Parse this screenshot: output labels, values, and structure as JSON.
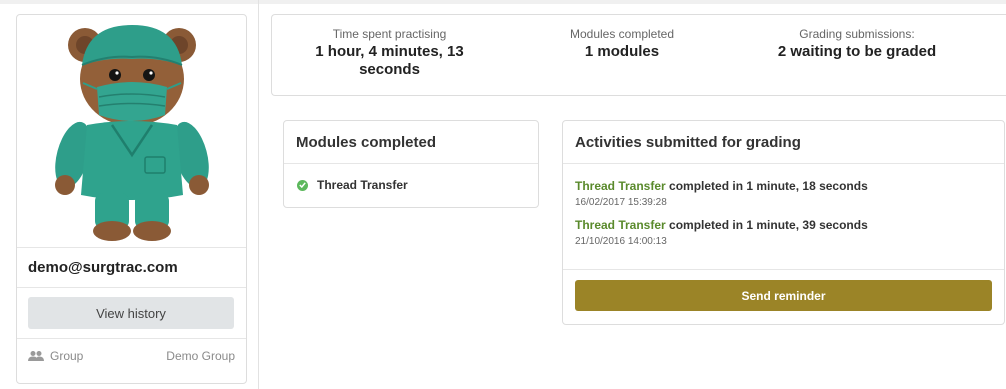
{
  "profile": {
    "avatar_alt": "teddy-bear-in-scrubs",
    "email": "demo@surgtrac.com",
    "view_history_label": "View history",
    "group_label": "Group",
    "group_value": "Demo Group"
  },
  "stats": [
    {
      "label": "Time spent practising",
      "value": "1 hour, 4 minutes, 13 seconds"
    },
    {
      "label": "Modules completed",
      "value": "1 modules"
    },
    {
      "label": "Grading submissions:",
      "value": "2 waiting to be graded"
    }
  ],
  "modules_card": {
    "title": "Modules completed",
    "items": [
      {
        "label": "Thread Transfer",
        "icon": "check-circle-icon"
      }
    ]
  },
  "activities_card": {
    "title": "Activities submitted for grading",
    "items": [
      {
        "module": "Thread Transfer",
        "text": " completed in 1 minute, 18 seconds",
        "date": "16/02/2017 15:39:28"
      },
      {
        "module": "Thread Transfer",
        "text": " completed in 1 minute, 39 seconds",
        "date": "21/10/2016 14:00:13"
      }
    ],
    "button_label": "Send reminder"
  },
  "colors": {
    "accent_gold": "#9b8427",
    "link_green": "#5a8a2c",
    "check_green": "#5cb85c"
  }
}
